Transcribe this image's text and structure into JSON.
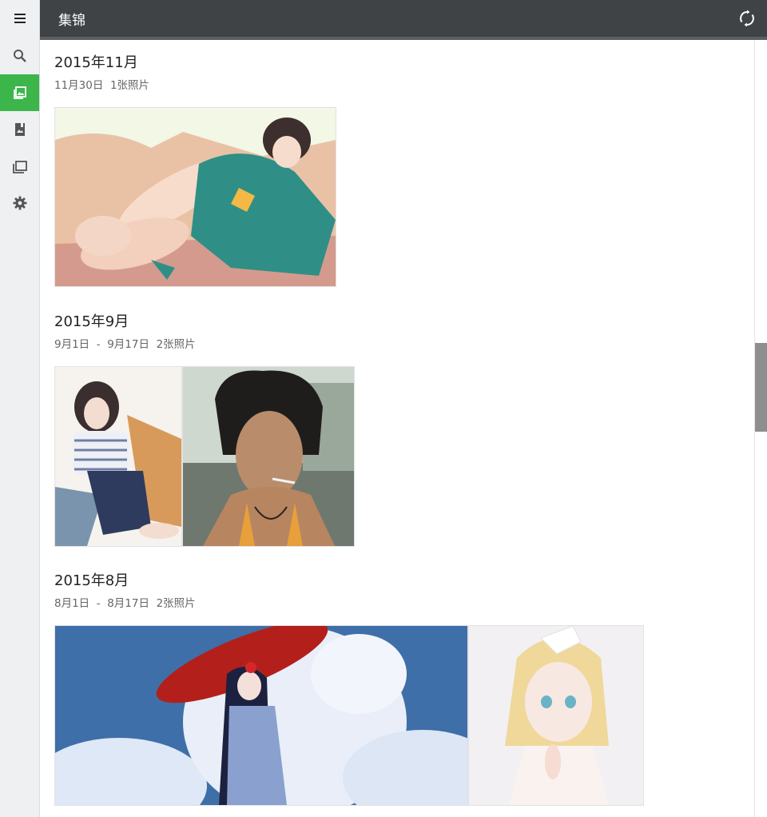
{
  "app": {
    "title": "集锦"
  },
  "sidebar": {
    "items": [
      {
        "name": "menu",
        "icon": "menu-icon",
        "active": false
      },
      {
        "name": "search",
        "icon": "search-icon",
        "active": false
      },
      {
        "name": "photos",
        "icon": "photos-icon",
        "active": true
      },
      {
        "name": "albums",
        "icon": "album-icon",
        "active": false
      },
      {
        "name": "collections",
        "icon": "collections-icon",
        "active": false
      },
      {
        "name": "settings",
        "icon": "gear-icon",
        "active": false
      }
    ],
    "accent": "#3cb54a"
  },
  "header": {
    "sync_icon": "sync-icon"
  },
  "sections": [
    {
      "title": "2015年11月",
      "subtitle": "11月30日  1张照片",
      "photos": [
        {
          "description": "anime girl lying in teal kimono"
        }
      ]
    },
    {
      "title": "2015年9月",
      "subtitle": "9月1日  -  9月17日  2张照片",
      "photos": [
        {
          "description": "anime girl in striped top sitting by water"
        },
        {
          "description": "man with messy hair smoking"
        }
      ]
    },
    {
      "title": "2015年8月",
      "subtitle": "8月1日  -  8月17日  2张照片",
      "photos": [
        {
          "description": "anime girl with red umbrella and clouds"
        },
        {
          "description": "blonde anime girl with ribbon"
        }
      ]
    }
  ]
}
